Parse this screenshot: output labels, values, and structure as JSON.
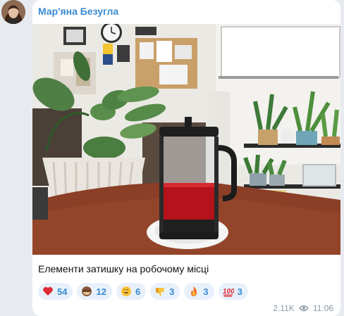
{
  "message": {
    "author": "Мар'яна Безугла",
    "caption": "Елементи затишку на робочому місці",
    "reactions": [
      {
        "emoji": "heart",
        "count": "54"
      },
      {
        "emoji": "see-no-evil-monkey",
        "count": "12"
      },
      {
        "emoji": "grinning-face",
        "count": "6"
      },
      {
        "emoji": "thumbs-down",
        "count": "3"
      },
      {
        "emoji": "fire",
        "count": "3"
      },
      {
        "emoji": "hundred-points",
        "count": "3"
      }
    ],
    "views": "2.11K",
    "time": "11:06"
  },
  "colors": {
    "author": "#3a8ad0",
    "reaction_bg": "#e8f1fb",
    "reaction_text": "#3a8ad0",
    "chat_bg": "#e7ebf0",
    "meta": "#8b98a5"
  }
}
